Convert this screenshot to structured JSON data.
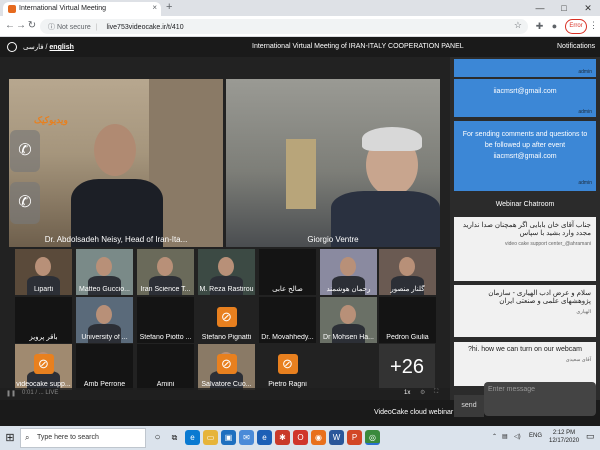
{
  "browser": {
    "tab_title": "International Virtual Meeting",
    "tab_close": "×",
    "new_tab": "+",
    "minimize": "—",
    "maximize": "□",
    "close": "✕",
    "security": "Not secure",
    "url": "live753videocake.ir/t/410",
    "error_label": "Error",
    "icons": [
      "back-icon",
      "forward-icon",
      "reload-icon",
      "info-icon",
      "star-icon",
      "puzzle-icon",
      "profile-icon",
      "menu-icon"
    ]
  },
  "app": {
    "lang_en": "english",
    "lang_fa": "فارسی /",
    "title": "International Virtual Meeting of IRAN-ITALY COOPERATION PANEL",
    "notifications": "Notifications"
  },
  "video": {
    "main_left_name": "Dr. Abdolsadeh Neisy, Head of Iran-Ita...",
    "main_right_name": "Giorgio Ventre",
    "logo_text": "ویدیوکیک",
    "overflow_count": "+26",
    "bottom_time": "0:01 / ...   LIVE",
    "tiles": [
      {
        "name": "Liparti",
        "kind": "video",
        "bg": "#5a4a3a"
      },
      {
        "name": "Matteo Guccio...",
        "kind": "video",
        "bg": "#7a8a88"
      },
      {
        "name": "Iran Science T...",
        "kind": "video",
        "bg": "#6a6a5a"
      },
      {
        "name": "M. Reza Rastirou",
        "kind": "video",
        "bg": "#3c4a44"
      },
      {
        "name": "صالح عابی",
        "kind": "dark",
        "bg": "#141414"
      },
      {
        "name": "رحمان هوشمند",
        "kind": "video",
        "bg": "#8a8aa0"
      },
      {
        "name": "گلنار منصور",
        "kind": "video",
        "bg": "#6a5a52"
      },
      {
        "name": "باقر پرویز",
        "kind": "dark",
        "bg": "#141414"
      },
      {
        "name": "University of ...",
        "kind": "video",
        "bg": "#5a6a7a"
      },
      {
        "name": "Stefano Piotto ...",
        "kind": "dark",
        "bg": "#141414"
      },
      {
        "name": "Stefano Pignatti",
        "kind": "camoff",
        "bg": "#222222"
      },
      {
        "name": "Dr. Movahhedy...",
        "kind": "dark",
        "bg": "#141414"
      },
      {
        "name": "Dr Mohsen Ha...",
        "kind": "video",
        "bg": "#6a7066"
      },
      {
        "name": "Pedron Giulia",
        "kind": "dark",
        "bg": "#141414"
      },
      {
        "name": "videocake supp...",
        "kind": "camoff-photo",
        "bg": "#a08a70"
      },
      {
        "name": "Amb Perrone",
        "kind": "dark",
        "bg": "#141414"
      },
      {
        "name": "Amini",
        "kind": "dark",
        "bg": "#141414"
      },
      {
        "name": "Salvatore Cuo...",
        "kind": "camoff-photo",
        "bg": "#8a7a66"
      },
      {
        "name": "Pietro Ragni",
        "kind": "camoff",
        "bg": "#222222"
      }
    ]
  },
  "notifications": [
    {
      "text": "",
      "who": "admin"
    },
    {
      "text": "iiacmsrt@gmail.com",
      "who": "admin"
    },
    {
      "text": "For sending comments and questions to be followed up after event iiacmsrt@gmail.com",
      "who": "admin"
    }
  ],
  "chat": {
    "header": "Webinar Chatroom",
    "messages": [
      {
        "text": "جناب آقای خان بابایی اگر همچنان صدا ندارید مجدد وارد بشید با سپاس",
        "sender": "video cake support center_@ahramani"
      },
      {
        "text": "سلام و عرض ادب الهیاری - سازمان پژوهشهای علمی و صنعتی ایران",
        "sender": "الهیاری"
      },
      {
        "text": "?hi. how we can turn on our webcam",
        "sender": "آقای سعیدی"
      }
    ],
    "send_label": "send",
    "input_placeholder": "Enter message"
  },
  "footer": {
    "brand": "VideoCake cloud webinar"
  },
  "taskbar": {
    "search_placeholder": "Type here to search",
    "lang": "ENG",
    "time": "2:12 PM",
    "date": "12/17/2020"
  }
}
